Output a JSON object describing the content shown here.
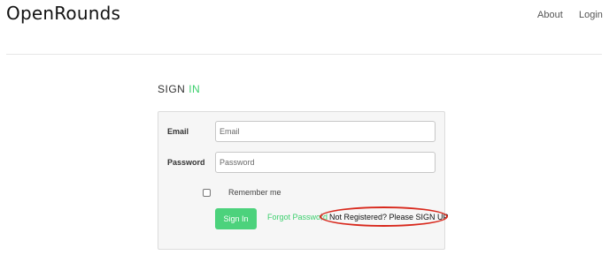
{
  "header": {
    "brand": "OpenRounds",
    "nav": {
      "about": "About",
      "login": "Login"
    }
  },
  "signin": {
    "title_prefix": "SIGN",
    "title_accent": "IN",
    "accent_color": "#3ccf6d",
    "email_label": "Email",
    "email_placeholder": "Email",
    "email_value": "",
    "password_label": "Password",
    "password_placeholder": "Password",
    "password_value": "",
    "remember_label": "Remember me",
    "remember_checked": false,
    "submit_label": "Sign In",
    "submit_color": "#4cd27c",
    "forgot_label": "Forgot Password",
    "separator": "|",
    "signup_label": "Not Registered? Please SIGN UP"
  },
  "annotation_color": "#d8281c"
}
